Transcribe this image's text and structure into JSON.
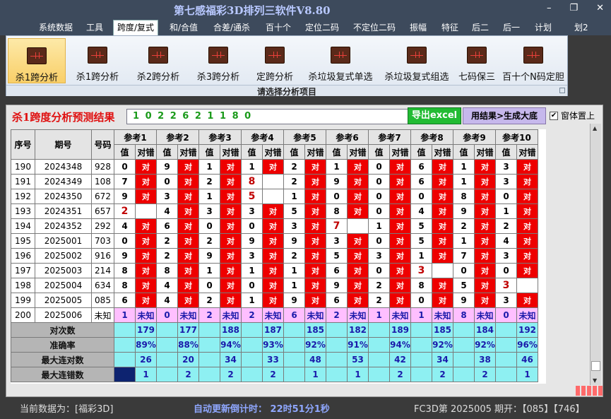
{
  "app": {
    "title": "第七感福彩3D排列三软件V8.80"
  },
  "menu": [
    "系统数据",
    "工具",
    "跨度/复式",
    "和/合值",
    "合差/通杀",
    "百十个",
    "定位二码",
    "不定位二码",
    "振幅",
    "特征",
    "后二",
    "后一",
    "计划",
    "划2"
  ],
  "menu_active": "跨度/复式",
  "ribbon": {
    "buttons": [
      "杀1跨分析",
      "杀1跨分析",
      "杀2跨分析",
      "杀3跨分析",
      "定跨分析",
      "杀垃圾复式单选",
      "杀垃圾复式组选",
      "七码保三",
      "百十个N码定胆"
    ],
    "active_index": 0,
    "group_label": "请选择分析项目"
  },
  "result": {
    "title": "杀1跨度分析预测结果",
    "value": "1 0 2 2 6 2 1 1 8 0",
    "excel_button": "导出excel",
    "generate_button": "用结果>生成大底",
    "topmost_label": "窗体置上",
    "topmost_checked": "✔"
  },
  "table": {
    "headers": {
      "seq": "序号",
      "period": "期号",
      "number": "号码",
      "value": "值",
      "check": "对错"
    },
    "refs": [
      "参考1",
      "参考2",
      "参考3",
      "参考4",
      "参考5",
      "参考6",
      "参考7",
      "参考8",
      "参考9",
      "参考10"
    ],
    "ok_text": "对",
    "rows": [
      {
        "seq": "190",
        "period": "2024348",
        "number": "928",
        "vals": [
          "0",
          "9",
          "1",
          "1",
          "2",
          "1",
          "0",
          "6",
          "1",
          "3"
        ],
        "ok": [
          1,
          1,
          1,
          1,
          1,
          1,
          1,
          1,
          1,
          1
        ]
      },
      {
        "seq": "191",
        "period": "2024349",
        "number": "108",
        "vals": [
          "7",
          "0",
          "2",
          "8",
          "2",
          "9",
          "0",
          "6",
          "1",
          "3"
        ],
        "ok": [
          1,
          1,
          1,
          0,
          1,
          1,
          1,
          1,
          1,
          1
        ]
      },
      {
        "seq": "192",
        "period": "2024350",
        "number": "672",
        "vals": [
          "9",
          "3",
          "1",
          "5",
          "1",
          "0",
          "0",
          "0",
          "8",
          "0"
        ],
        "ok": [
          1,
          1,
          1,
          0,
          1,
          1,
          1,
          1,
          1,
          1
        ]
      },
      {
        "seq": "193",
        "period": "2024351",
        "number": "657",
        "vals": [
          "2",
          "4",
          "3",
          "3",
          "5",
          "8",
          "0",
          "4",
          "9",
          "1"
        ],
        "ok": [
          0,
          1,
          1,
          1,
          1,
          1,
          1,
          1,
          1,
          1
        ]
      },
      {
        "seq": "194",
        "period": "2024352",
        "number": "292",
        "vals": [
          "4",
          "6",
          "0",
          "0",
          "3",
          "7",
          "1",
          "5",
          "2",
          "2"
        ],
        "ok": [
          1,
          1,
          1,
          1,
          1,
          0,
          1,
          1,
          1,
          1
        ]
      },
      {
        "seq": "195",
        "period": "2025001",
        "number": "703",
        "vals": [
          "0",
          "2",
          "2",
          "9",
          "9",
          "3",
          "0",
          "5",
          "1",
          "4"
        ],
        "ok": [
          1,
          1,
          1,
          1,
          1,
          1,
          1,
          1,
          1,
          1
        ]
      },
      {
        "seq": "196",
        "period": "2025002",
        "number": "916",
        "vals": [
          "9",
          "2",
          "9",
          "3",
          "2",
          "5",
          "3",
          "1",
          "7",
          "3"
        ],
        "ok": [
          1,
          1,
          1,
          1,
          1,
          1,
          1,
          1,
          1,
          1
        ]
      },
      {
        "seq": "197",
        "period": "2025003",
        "number": "214",
        "vals": [
          "8",
          "8",
          "1",
          "1",
          "1",
          "6",
          "0",
          "3",
          "0",
          "0"
        ],
        "ok": [
          1,
          1,
          1,
          1,
          1,
          1,
          1,
          0,
          1,
          1
        ]
      },
      {
        "seq": "198",
        "period": "2025004",
        "number": "634",
        "vals": [
          "8",
          "4",
          "0",
          "0",
          "1",
          "9",
          "2",
          "8",
          "5",
          "3"
        ],
        "ok": [
          1,
          1,
          1,
          1,
          1,
          1,
          1,
          1,
          1,
          0
        ]
      },
      {
        "seq": "199",
        "period": "2025005",
        "number": "085",
        "vals": [
          "6",
          "4",
          "2",
          "1",
          "9",
          "6",
          "2",
          "0",
          "9",
          "3"
        ],
        "ok": [
          1,
          1,
          1,
          1,
          1,
          1,
          1,
          1,
          1,
          1
        ]
      }
    ],
    "highlight": [
      [
        1,
        3
      ],
      [
        2,
        3
      ],
      [
        3,
        0
      ],
      [
        4,
        5
      ],
      [
        7,
        7
      ],
      [
        8,
        9
      ]
    ],
    "unknown_row": {
      "seq": "200",
      "period": "2025006",
      "number": "未知",
      "vals": [
        "1",
        "0",
        "2",
        "2",
        "6",
        "2",
        "1",
        "1",
        "8",
        "0"
      ],
      "text": "未知"
    },
    "stats": [
      {
        "label": "对次数",
        "values": [
          "179",
          "177",
          "188",
          "187",
          "185",
          "182",
          "189",
          "185",
          "184",
          "192"
        ]
      },
      {
        "label": "准确率",
        "values": [
          "89%",
          "88%",
          "94%",
          "93%",
          "92%",
          "91%",
          "94%",
          "92%",
          "92%",
          "96%"
        ]
      },
      {
        "label": "最大连对数",
        "values": [
          "26",
          "20",
          "34",
          "33",
          "48",
          "53",
          "42",
          "34",
          "38",
          "46"
        ]
      },
      {
        "label": "最大连错数",
        "values": [
          "1",
          "2",
          "2",
          "2",
          "1",
          "1",
          "2",
          "2",
          "2",
          "1"
        ]
      }
    ]
  },
  "status": {
    "data_source": "当前数据为：[福彩3D]",
    "countdown": "自动更新倒计时：  22时51分1秒",
    "draw_info": "FC3D第 2025005 期开：【085】【746】"
  },
  "colors": {
    "ok": "#ee0000",
    "stat": "#8ef0f2",
    "unknown": "#ffbfff",
    "accent_title": "#e01010"
  }
}
